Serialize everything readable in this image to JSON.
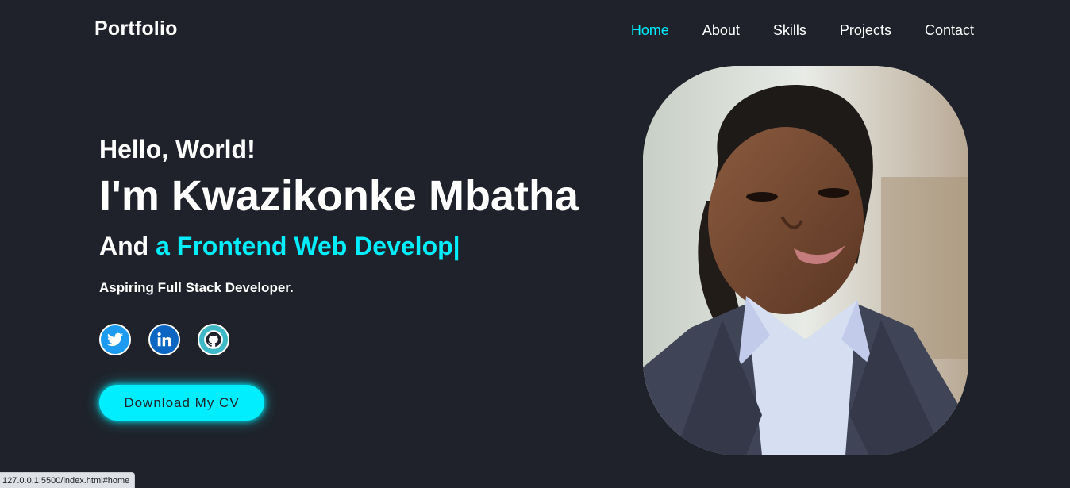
{
  "header": {
    "logo": "Portfolio",
    "nav": [
      {
        "label": "Home",
        "active": true
      },
      {
        "label": "About",
        "active": false
      },
      {
        "label": "Skills",
        "active": false
      },
      {
        "label": "Projects",
        "active": false
      },
      {
        "label": "Contact",
        "active": false
      }
    ]
  },
  "hero": {
    "greeting": "Hello, World!",
    "name": "I'm Kwazikonke Mbatha",
    "role_prefix": "And ",
    "role_typed": "a Frontend Web Develop",
    "role_caret": "|",
    "tagline": "Aspiring Full Stack Developer.",
    "socials": [
      {
        "icon": "twitter-icon"
      },
      {
        "icon": "linkedin-icon"
      },
      {
        "icon": "github-icon"
      }
    ],
    "cv_button": "Download My CV"
  },
  "status_bar": {
    "url": "127.0.0.1:5500/index.html#home"
  },
  "colors": {
    "background": "#1f222a",
    "accent": "#00eeff",
    "text": "#ffffff"
  }
}
